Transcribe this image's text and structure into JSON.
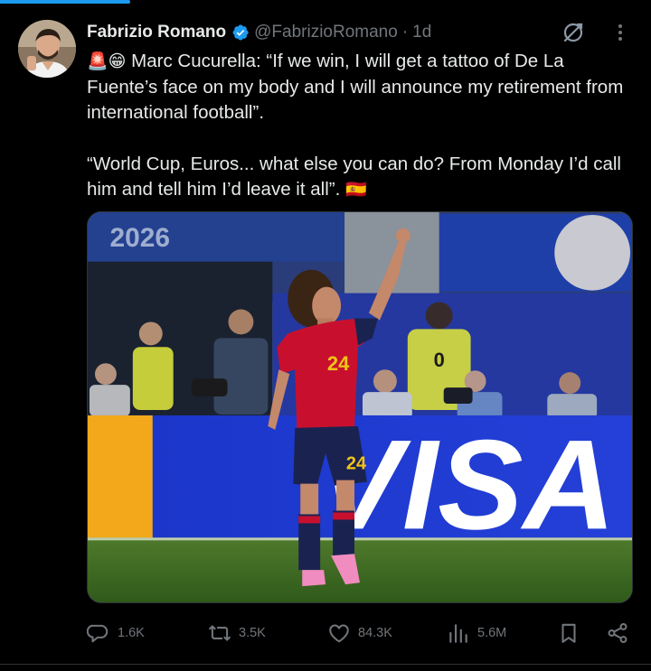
{
  "post": {
    "author_name": "Fabrizio Romano",
    "handle": "@FabrizioRomano",
    "separator": "·",
    "time": "1d",
    "emoji_prefix": "🚨😁",
    "paragraph1": "Marc Cucurella: “If we win, I will get a tattoo of De La Fuente’s face on my body and I will announce my retirement from international football”.",
    "paragraph2": "“World Cup, Euros... what else you can do? From Monday I’d call him and tell him I’d leave it all”.",
    "flag_emoji": "🇪🇸",
    "media": {
      "banner_text": "2026",
      "ad_board_text": "VISA",
      "jersey_number": "24",
      "vest_number": "0"
    }
  },
  "actions": {
    "replies": "1.6K",
    "reposts": "3.5K",
    "likes": "84.3K",
    "views": "5.6M"
  },
  "icons": {
    "verified": "verified-badge-icon",
    "grok": "grok-icon",
    "more": "more-icon",
    "reply": "reply-icon",
    "repost": "repost-icon",
    "like": "like-icon",
    "views": "views-icon",
    "bookmark": "bookmark-icon",
    "share": "share-icon"
  },
  "colors": {
    "background": "#000000",
    "text": "#e7e9ea",
    "secondary_text": "#71767b",
    "accent": "#1d9bf0",
    "spain_red": "#c8102e",
    "visa_blue": "#1a35c8"
  }
}
